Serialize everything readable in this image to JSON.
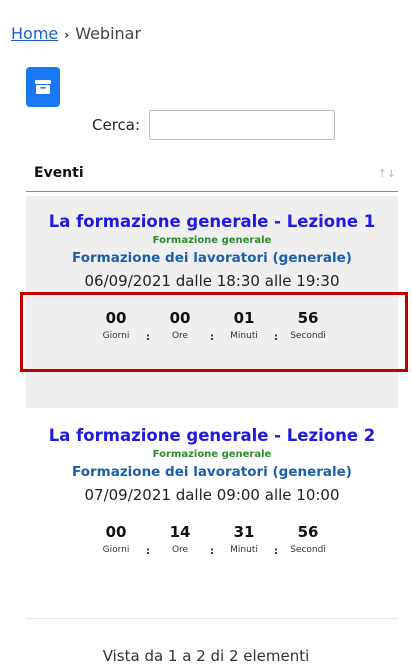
{
  "breadcrumb": {
    "home": "Home",
    "current": "Webinar"
  },
  "toolbar": {
    "archive_icon": "archive-box-icon",
    "accent": "#1877f2"
  },
  "search": {
    "label": "Cerca:",
    "value": "",
    "placeholder": ""
  },
  "table": {
    "header": "Eventi",
    "sort_icon": "sort-arrows-icon"
  },
  "events": [
    {
      "title": "La formazione generale - Lezione 1",
      "category": "Formazione generale",
      "course": "Formazione dei lavoratori (generale)",
      "datetime": "06/09/2021 dalle 18:30 alle 19:30",
      "countdown": {
        "days": "00",
        "hours": "00",
        "minutes": "01",
        "seconds": "56"
      },
      "labels": {
        "days": "Giorni",
        "hours": "Ore",
        "minutes": "Minuti",
        "seconds": "Secondi"
      }
    },
    {
      "title": "La formazione generale - Lezione 2",
      "category": "Formazione generale",
      "course": "Formazione dei lavoratori (generale)",
      "datetime": "07/09/2021 dalle 09:00 alle 10:00",
      "countdown": {
        "days": "00",
        "hours": "14",
        "minutes": "31",
        "seconds": "56"
      },
      "labels": {
        "days": "Giorni",
        "hours": "Ore",
        "minutes": "Minuti",
        "seconds": "Secondi"
      }
    }
  ],
  "footer": {
    "info": "Vista da 1 a 2 di 2 elementi"
  },
  "colors": {
    "title": "#1f1ae0",
    "category": "#2d8b2d",
    "course": "#1c5fa8",
    "highlight": "#c00000"
  }
}
